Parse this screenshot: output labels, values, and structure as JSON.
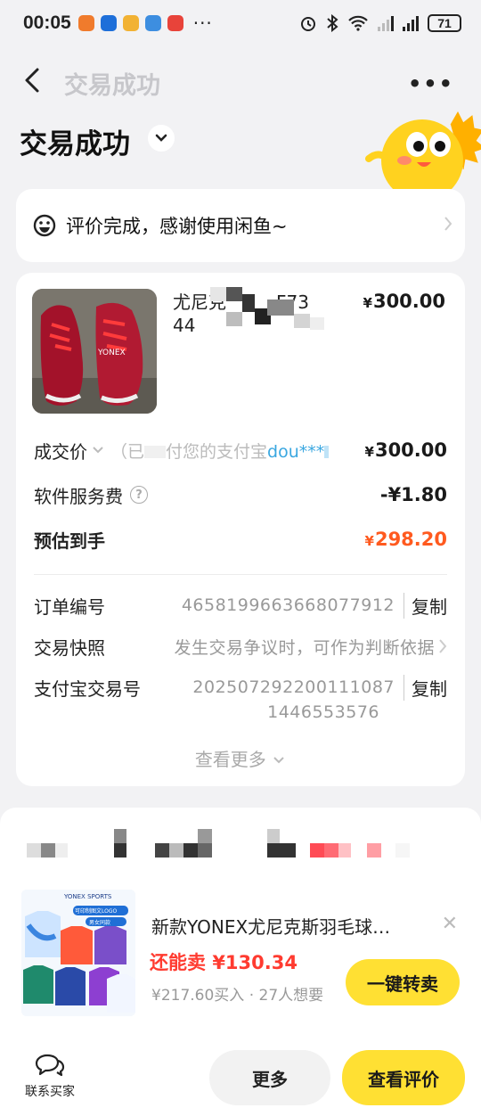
{
  "status_bar": {
    "time": "00:05",
    "dots": "···",
    "battery": "71",
    "app_icon_colors": [
      "#f07b2c",
      "#1e6fd9",
      "#f2b233",
      "#3d8ee0",
      "#e8433a"
    ]
  },
  "nav": {
    "back_icon": "back-arrow-icon",
    "title": "交易成功",
    "more_icon": "more-dots-icon"
  },
  "header": {
    "title": "交易成功",
    "chevron_icon": "chevron-down-icon"
  },
  "review_banner": {
    "text": "评价完成，感谢使用闲鱼~",
    "icon": "smile-face-icon"
  },
  "product": {
    "name_line1": "尤尼克",
    "name_line1_tail": "F73",
    "name_line2": "44",
    "price": "300.00",
    "currency": "¥"
  },
  "price_rows": {
    "deal_price_label": "成交价",
    "deal_price_note": "（已",
    "deal_price_note_mid": "付您的支付宝",
    "deal_price_note_link": "dou***",
    "deal_price_note_end": "）",
    "deal_price": "300.00",
    "service_fee_label": "软件服务费",
    "service_fee": "-¥1.80",
    "estimated_label": "预估到手",
    "estimated": "298.20"
  },
  "info_rows": {
    "order_no_label": "订单编号",
    "order_no": "4658199663668077912",
    "copy_label": "复制",
    "snapshot_label": "交易快照",
    "snapshot_value": "发生交易争议时，可作为判断依据",
    "alipay_label": "支付宝交易号",
    "alipay_no_line1": "20250729220011108​7",
    "alipay_no_line2": "1446553576",
    "see_more": "查看更多"
  },
  "resell": {
    "title": "新款YONEX尤尼克斯羽毛球…",
    "price_prefix": "还能卖",
    "price": "¥130.34",
    "meta": "¥217.60买入 · 27人想要",
    "button": "一键转卖",
    "img_label": "YONEX SPORTS",
    "img_tag1": "可印制图文LOGO",
    "img_tag2": "男女同款"
  },
  "bottom_bar": {
    "contact_label": "联系买家",
    "more_button": "更多",
    "review_button": "查看评价"
  },
  "colors": {
    "accent_yellow": "#ffe033",
    "orange": "#ff5a1f",
    "red": "#ff3b30",
    "background": "#f2f2f4"
  }
}
